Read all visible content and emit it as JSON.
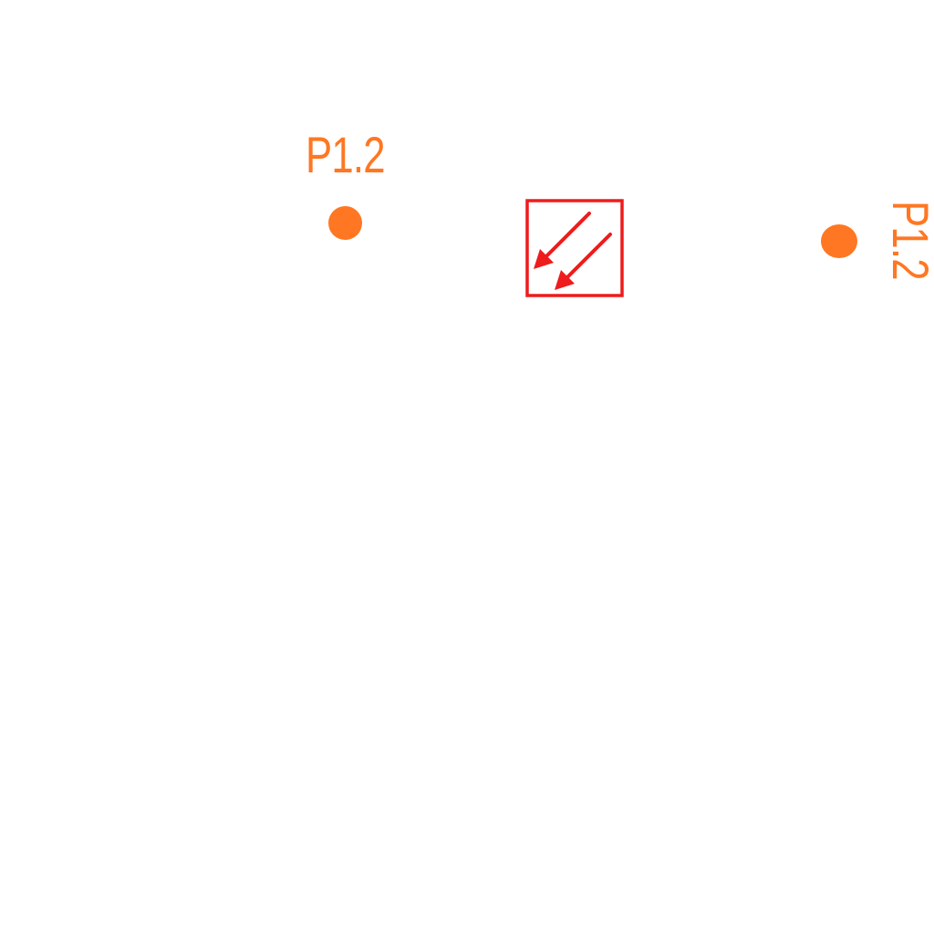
{
  "pins": [
    {
      "label": "P1.2"
    },
    {
      "label": "P1.2"
    }
  ],
  "symbol": {
    "icon": "double-diagonal-arrows-icon"
  },
  "colors": {
    "pin": "#ff7722",
    "symbol": "#ee1c1c",
    "background": "#ffffff"
  }
}
